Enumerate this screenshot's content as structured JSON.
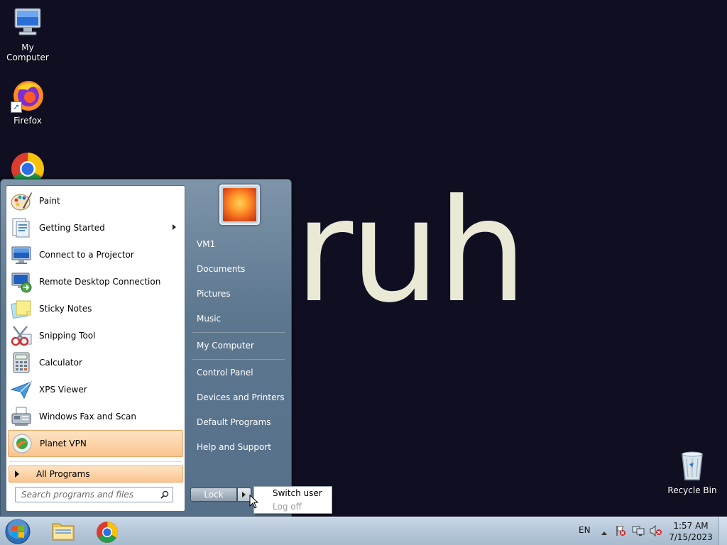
{
  "wallpaper": {
    "text": "ruh"
  },
  "desktop_icons": [
    {
      "label": "My Computer"
    },
    {
      "label": "Firefox"
    },
    {
      "label": "Recycle Bin"
    }
  ],
  "start_menu": {
    "programs": [
      {
        "label": "Paint"
      },
      {
        "label": "Getting Started"
      },
      {
        "label": "Connect to a Projector"
      },
      {
        "label": "Remote Desktop Connection"
      },
      {
        "label": "Sticky Notes"
      },
      {
        "label": "Snipping Tool"
      },
      {
        "label": "Calculator"
      },
      {
        "label": "XPS Viewer"
      },
      {
        "label": "Windows Fax and Scan"
      },
      {
        "label": "Planet VPN"
      }
    ],
    "all_programs": "All Programs",
    "search_placeholder": "Search programs and files",
    "right_items": [
      {
        "label": "VM1"
      },
      {
        "label": "Documents"
      },
      {
        "label": "Pictures"
      },
      {
        "label": "Music"
      },
      {
        "label": "My Computer"
      },
      {
        "label": "Control Panel"
      },
      {
        "label": "Devices and Printers"
      },
      {
        "label": "Default Programs"
      },
      {
        "label": "Help and Support"
      }
    ],
    "lock_label": "Lock",
    "flyout": [
      {
        "label": "Switch user"
      },
      {
        "label": "Log off"
      }
    ]
  },
  "taskbar": {
    "language": "EN",
    "clock_time": "1:57 AM",
    "clock_date": "7/15/2023"
  },
  "colors": {
    "desktop_bg": "#100f22",
    "highlight": "#fbc48e",
    "taskbar": "#b5c7d9"
  }
}
